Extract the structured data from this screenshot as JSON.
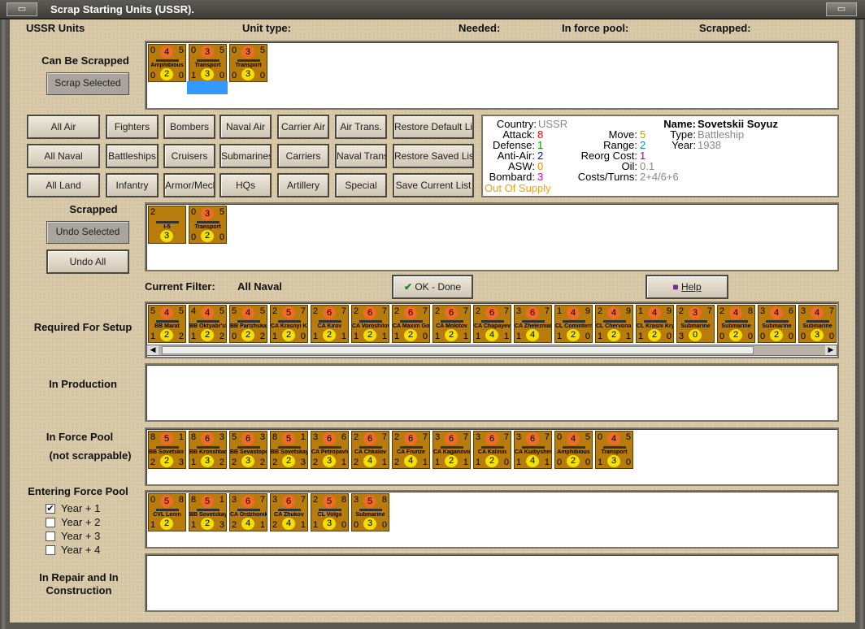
{
  "title": "Scrap Starting Units (USSR).",
  "headers": {
    "units": "USSR Units",
    "unit_type": "Unit type:",
    "needed": "Needed:",
    "force_pool": "In force pool:",
    "scrapped": "Scrapped:"
  },
  "labels": {
    "can_be_scrapped": "Can Be Scrapped",
    "scrapped": "Scrapped",
    "current_filter_label": "Current Filter:",
    "current_filter_value": "All Naval",
    "required": "Required For Setup",
    "production": "In Production",
    "force_pool_1": "In Force Pool",
    "force_pool_2": "(not scrappable)",
    "entering": "Entering Force Pool",
    "repair_1": "In Repair and In",
    "repair_2": "Construction"
  },
  "buttons": {
    "scrap_selected": "Scrap Selected",
    "undo_selected": "Undo Selected",
    "undo_all": "Undo All",
    "ok": "OK - Done",
    "help": "Help",
    "filters": [
      [
        "All Air",
        "Fighters",
        "Bombers",
        "Naval Air",
        "Carrier Air",
        "Air Trans.",
        "Restore Default List"
      ],
      [
        "All Naval",
        "Battleships",
        "Cruisers",
        "Submarines",
        "Carriers",
        "Naval Trans.",
        "Restore Saved List"
      ],
      [
        "All Land",
        "Infantry",
        "Armor/Mech",
        "HQs",
        "Artillery",
        "Special",
        "Save Current List"
      ]
    ]
  },
  "info": {
    "country_l": "Country:",
    "country_v": "USSR",
    "attack_l": "Attack:",
    "attack_v": "8",
    "defense_l": "Defense:",
    "defense_v": "1",
    "antiair_l": "Anti-Air:",
    "antiair_v": "2",
    "asw_l": "ASW:",
    "asw_v": "0",
    "bombard_l": "Bombard:",
    "bombard_v": "3",
    "supply": "Out Of Supply",
    "move_l": "Move:",
    "move_v": "5",
    "range_l": "Range:",
    "range_v": "2",
    "reorg_l": "Reorg Cost:",
    "reorg_v": "1",
    "oil_l": "Oil:",
    "oil_v": "0.1",
    "costs_l": "Costs/Turns:",
    "costs_v": "2+4/6+6",
    "name_l": "Name:",
    "name_v": "Sovetskii Soyuz",
    "type_l": "Type:",
    "type_v": "Battleship",
    "year_l": "Year:",
    "year_v": "1938"
  },
  "years": [
    {
      "label": "Year + 1",
      "checked": true
    },
    {
      "label": "Year + 2",
      "checked": false
    },
    {
      "label": "Year + 3",
      "checked": false
    },
    {
      "label": "Year + 4",
      "checked": false
    }
  ],
  "can_scrap": [
    [
      "0",
      "4",
      "5",
      "Amphibious",
      "0",
      "2",
      "0"
    ],
    [
      "0",
      "3",
      "5",
      "Transport",
      "1",
      "3",
      "0"
    ],
    [
      "0",
      "3",
      "5",
      "Transport",
      "0",
      "3",
      "0"
    ]
  ],
  "scrapped_units": [
    [
      "2",
      "",
      "",
      "I-5",
      "",
      "3",
      ""
    ],
    [
      "0",
      "3",
      "5",
      "Transport",
      "0",
      "2",
      "0"
    ]
  ],
  "required": [
    [
      "5",
      "4",
      "5",
      "BB Marat",
      "1",
      "2",
      "2"
    ],
    [
      "4",
      "4",
      "5",
      "BB Oktyabr'skaya Revolutsiya",
      "1",
      "2",
      "2"
    ],
    [
      "5",
      "4",
      "5",
      "BB Parizhskaya Kommuna",
      "0",
      "2",
      "2"
    ],
    [
      "2",
      "5",
      "7",
      "CA Krasnyi Kavkaz",
      "1",
      "2",
      "0"
    ],
    [
      "2",
      "6",
      "7",
      "CA Kirov",
      "1",
      "2",
      "1"
    ],
    [
      "2",
      "6",
      "7",
      "CA Voroshilov",
      "1",
      "2",
      "1"
    ],
    [
      "2",
      "6",
      "7",
      "CA Maxim Gorki",
      "1",
      "2",
      "0"
    ],
    [
      "2",
      "6",
      "7",
      "CA Molotov",
      "1",
      "2",
      "1"
    ],
    [
      "2",
      "6",
      "7",
      "CA Chapayev",
      "1",
      "4",
      "1"
    ],
    [
      "3",
      "6",
      "7",
      "CA Zhelezniakov",
      "1",
      "4",
      ""
    ],
    [
      "1",
      "4",
      "9",
      "CL Comintern",
      "1",
      "2",
      "0"
    ],
    [
      "2",
      "4",
      "9",
      "CL Chervona Ukraina",
      "1",
      "2",
      "1"
    ],
    [
      "1",
      "4",
      "9",
      "CL Krasni Krym",
      "1",
      "2",
      "0"
    ],
    [
      "2",
      "3",
      "7",
      "Submarine",
      "3",
      "0",
      ""
    ],
    [
      "2",
      "4",
      "8",
      "Submarine",
      "0",
      "2",
      "0"
    ],
    [
      "3",
      "4",
      "6",
      "Submarine",
      "0",
      "2",
      "0"
    ],
    [
      "3",
      "4",
      "7",
      "Submarine",
      "0",
      "3",
      "0"
    ]
  ],
  "force_pool": [
    [
      "8",
      "5",
      "1",
      "BB Sovetskii Soyuz",
      "2",
      "2",
      "3"
    ],
    [
      "8",
      "6",
      "3",
      "BB Kronshtadt",
      "1",
      "3",
      "2"
    ],
    [
      "5",
      "6",
      "3",
      "BB Sevastopol",
      "2",
      "3",
      "2"
    ],
    [
      "8",
      "5",
      "1",
      "BB Sovetskaya Ukraina",
      "2",
      "2",
      "3"
    ],
    [
      "3",
      "6",
      "6",
      "CA Petropavlovsk",
      "2",
      "3",
      "1"
    ],
    [
      "2",
      "6",
      "7",
      "CA Chkalov",
      "2",
      "4",
      "1"
    ],
    [
      "2",
      "6",
      "7",
      "CA Frunze",
      "2",
      "4",
      "1"
    ],
    [
      "3",
      "6",
      "7",
      "CA Kaganovich",
      "1",
      "2",
      "1"
    ],
    [
      "3",
      "6",
      "7",
      "CA Kalinin",
      "1",
      "2",
      "0"
    ],
    [
      "3",
      "6",
      "7",
      "CA Kuibyshev",
      "1",
      "4",
      "1"
    ],
    [
      "0",
      "4",
      "5",
      "Amphibious",
      "0",
      "2",
      "0"
    ],
    [
      "0",
      "4",
      "5",
      "Transport",
      "1",
      "3",
      "0"
    ]
  ],
  "entering": [
    [
      "0",
      "5",
      "8",
      "CVL Lenin",
      "1",
      "2",
      ""
    ],
    [
      "8",
      "5",
      "1",
      "BB Sovetskaya Belorossiya",
      "1",
      "2",
      "3"
    ],
    [
      "3",
      "6",
      "7",
      "CA Ordzhonikidze",
      "2",
      "4",
      "1"
    ],
    [
      "3",
      "6",
      "7",
      "CA Zhukov",
      "2",
      "4",
      "1"
    ],
    [
      "2",
      "5",
      "8",
      "CL Volga",
      "1",
      "3",
      "0"
    ],
    [
      "3",
      "5",
      "8",
      "Submarine",
      "0",
      "3",
      "0"
    ]
  ]
}
